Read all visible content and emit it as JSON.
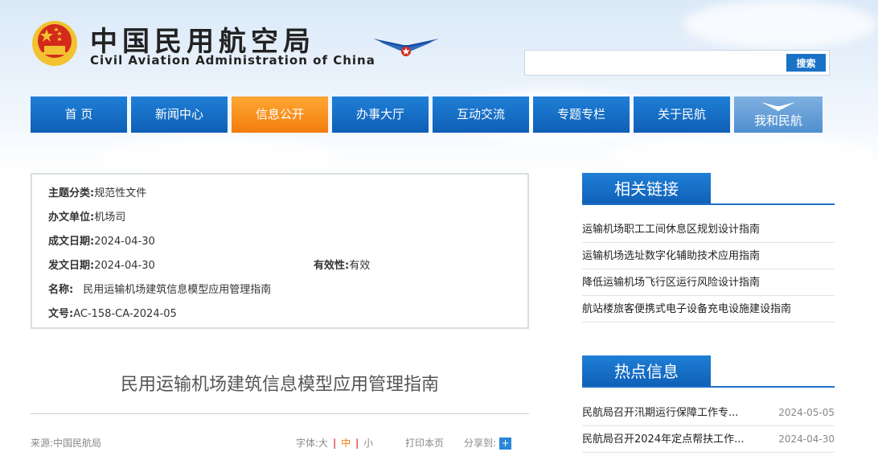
{
  "header": {
    "cn_title": "中国民用航空局",
    "en_title": "Civil Aviation Administration of China"
  },
  "search": {
    "placeholder": "",
    "button_label": "搜索"
  },
  "nav": {
    "items": [
      {
        "label": "首 页"
      },
      {
        "label": "新闻中心"
      },
      {
        "label": "信息公开"
      },
      {
        "label": "办事大厅"
      },
      {
        "label": "互动交流"
      },
      {
        "label": "专题专栏"
      },
      {
        "label": "关于民航"
      },
      {
        "label": "我和民航"
      }
    ],
    "active_index": 2
  },
  "info": {
    "topic_label": "主题分类:",
    "topic_value": "规范性文件",
    "office_label": "办文单位:",
    "office_value": "机场司",
    "created_label": "成文日期:",
    "created_value": "2024-04-30",
    "issued_label": "发文日期:",
    "issued_value": "2024-04-30",
    "validity_label": "有效性:",
    "validity_value": "有效",
    "name_label": "名称:",
    "name_value": "民用运输机场建筑信息模型应用管理指南",
    "docno_label": "文号:",
    "docno_value": "AC-158-CA-2024-05"
  },
  "article": {
    "title": "民用运输机场建筑信息模型应用管理指南",
    "source": "来源:中国民航局",
    "font_label": "字体:",
    "size_large": "大",
    "size_medium": "中",
    "size_small": "小",
    "print_label": "打印本页",
    "share_label": "分享到:",
    "share_icon": "+"
  },
  "related": {
    "heading": "相关链接",
    "items": [
      "运输机场职工工间休息区规划设计指南",
      "运输机场选址数字化辅助技术应用指南",
      "降低运输机场飞行区运行风险设计指南",
      "航站楼旅客便携式电子设备充电设施建设指南"
    ]
  },
  "hot": {
    "heading": "热点信息",
    "items": [
      {
        "title": "民航局召开汛期运行保障工作专...",
        "date": "2024-05-05"
      },
      {
        "title": "民航局召开2024年定点帮扶工作...",
        "date": "2024-04-30"
      }
    ]
  },
  "colors": {
    "nav_blue": "#1a6fc9",
    "nav_active": "#f58a1f",
    "accent_red": "#d32a1c",
    "emblem_gold": "#f2c230"
  }
}
